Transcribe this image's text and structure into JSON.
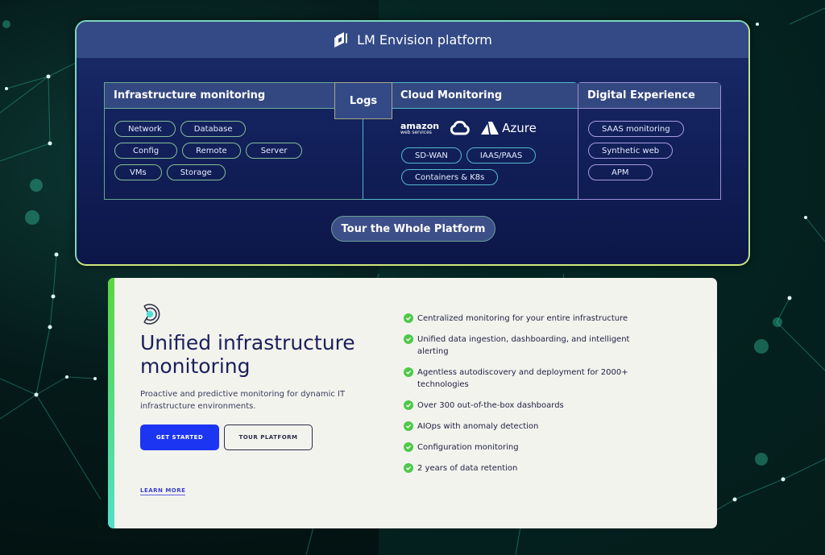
{
  "platform": {
    "title": "LM Envision platform",
    "logo_icon": "lm-logo-icon",
    "columns": {
      "infrastructure": {
        "title": "Infrastructure monitoring",
        "pills": [
          "Network",
          "Database",
          "Config",
          "Remote",
          "Server",
          "VMs",
          "Storage"
        ]
      },
      "logs": {
        "title": "Logs"
      },
      "cloud": {
        "title": "Cloud Monitoring",
        "logos": {
          "aws": "amazon",
          "aws_sub": "web services",
          "azure": "Azure"
        },
        "pills": [
          "SD-WAN",
          "IAAS/PAAS",
          "Containers & K8s"
        ]
      },
      "digital": {
        "title": "Digital Experience",
        "pills": [
          "SAAS monitoring",
          "Synthetic web",
          "APM"
        ]
      }
    },
    "tour_button": "Tour the Whole Platform"
  },
  "card": {
    "icon": "product-target-icon",
    "title": "Unified infrastructure monitoring",
    "description": "Proactive and predictive monitoring for dynamic IT infrastructure environments.",
    "primary_button": "GET STARTED",
    "secondary_button": "TOUR PLATFORM",
    "learn_more": "LEARN MORE",
    "features": [
      "Centralized monitoring for your entire infrastructure",
      "Unified data ingestion, dashboarding, and intelligent alerting",
      "Agentless autodiscovery and deployment for 2000+ technologies",
      "Over 300 out-of-the-box dashboards",
      "AIOps with anomaly detection",
      "Configuration monitoring",
      "2 years of data retention"
    ]
  },
  "colors": {
    "accent_blue": "#1c35f2",
    "check_green": "#4fc84a",
    "panel_navy": "#12205a",
    "teal_accent": "#4fe0c8"
  }
}
